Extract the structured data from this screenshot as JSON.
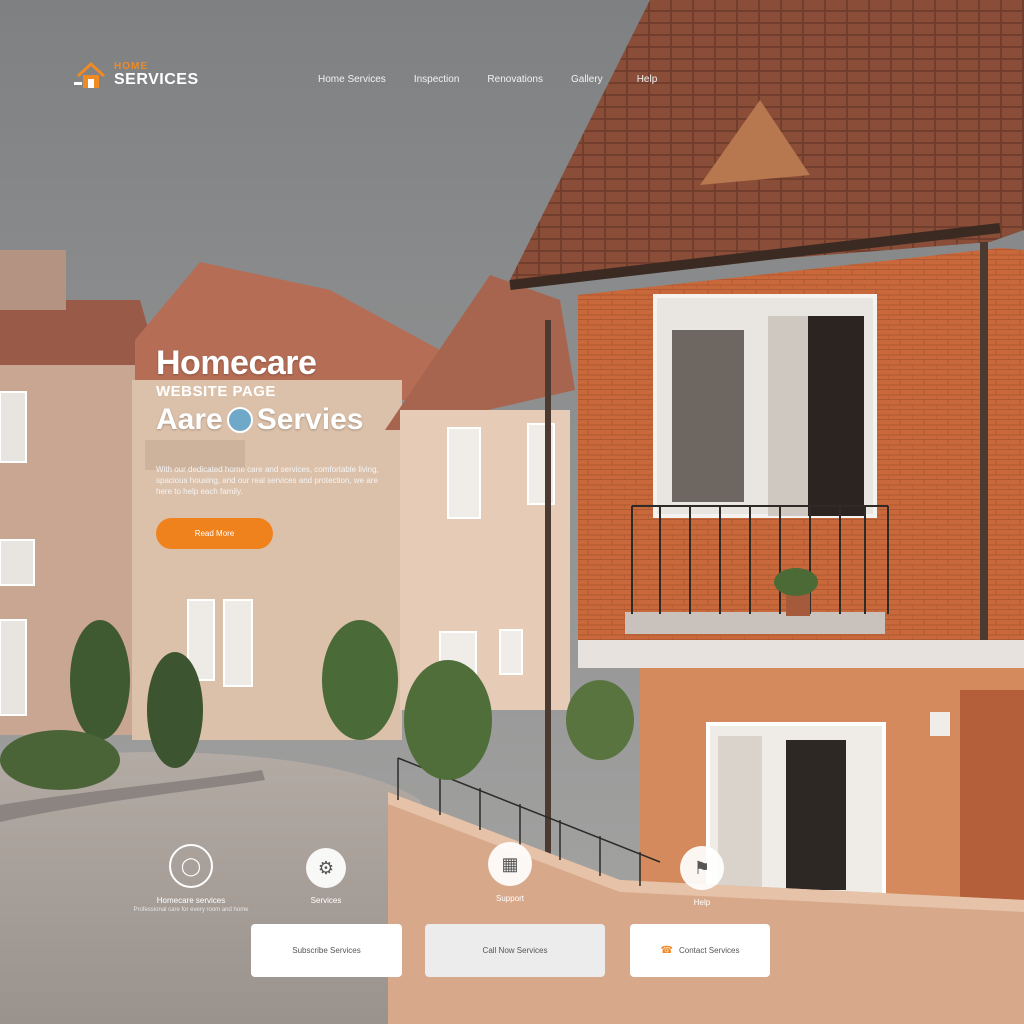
{
  "brand": {
    "top": "HOME",
    "name": "SERVICES",
    "accent_color": "#f08a24"
  },
  "nav": [
    "Home Services",
    "Inspection",
    "Renovations",
    "Gallery",
    "Help"
  ],
  "hero": {
    "line1": "Homecare",
    "line2": "WEBSITE PAGE",
    "line3_prefix": "Aare",
    "line3_suffix": "Servies",
    "description": "With our dedicated home care and services, comfortable living, spacious housing, and our real services and protection, we are here to help each family.",
    "cta_label": "Read More"
  },
  "services": [
    {
      "label": "Homecare services",
      "sub": "Professional care for every room and home",
      "icon": "chat-bubble-icon"
    },
    {
      "label": "Services",
      "icon": "tool-icon"
    },
    {
      "label": "Support",
      "icon": "calendar-icon"
    },
    {
      "label": "Help",
      "icon": "sign-icon"
    }
  ],
  "cards": [
    "Subscribe Services",
    "Call Now Services",
    "Contact Services"
  ],
  "colors": {
    "cta": "#f0821e",
    "card_bg": "#ffffff",
    "card_mid_bg": "#ececec"
  }
}
